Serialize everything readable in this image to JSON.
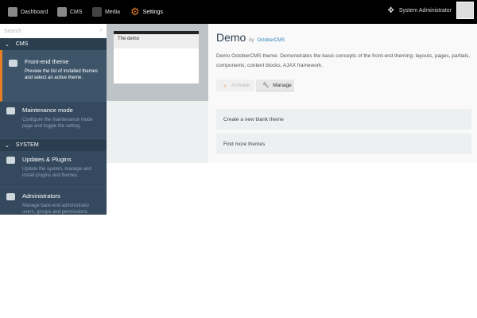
{
  "topnav": {
    "items": [
      {
        "label": "Dashboard",
        "icon": "dashboard-icon"
      },
      {
        "label": "CMS",
        "icon": "cms-icon"
      },
      {
        "label": "Media",
        "icon": "media-icon"
      },
      {
        "label": "Settings",
        "icon": "gear-icon"
      }
    ],
    "user": "System Administrator"
  },
  "sidebar": {
    "search_placeholder": "Search",
    "sections": [
      {
        "label": "CMS"
      },
      {
        "label": "SYSTEM"
      }
    ],
    "items": [
      {
        "title": "Front-end theme",
        "desc": "Preview the list of installed themes and select an active theme."
      },
      {
        "title": "Maintenance mode",
        "desc": "Configure the maintenance mode page and toggle the setting."
      },
      {
        "title": "Updates & Plugins",
        "desc": "Update the system, manage and install plugins and themes."
      },
      {
        "title": "Administrators",
        "desc": "Manage back-end administrator users, groups and permissions."
      }
    ]
  },
  "theme": {
    "name": "Demo",
    "by": "by",
    "author": "OctoberCMS",
    "preview_title": "The demo",
    "description": "Demo OctoberCMS theme. Demonstrates the basic concepts of the front-end theming: layouts, pages, partials, components, content blocks, AJAX framework.",
    "activate": "Activate",
    "manage": "Manage"
  },
  "cards": [
    "Create a new blank theme",
    "Find more themes"
  ],
  "colors": {
    "accent": "#e67e22",
    "sidebar": "#34495e"
  }
}
